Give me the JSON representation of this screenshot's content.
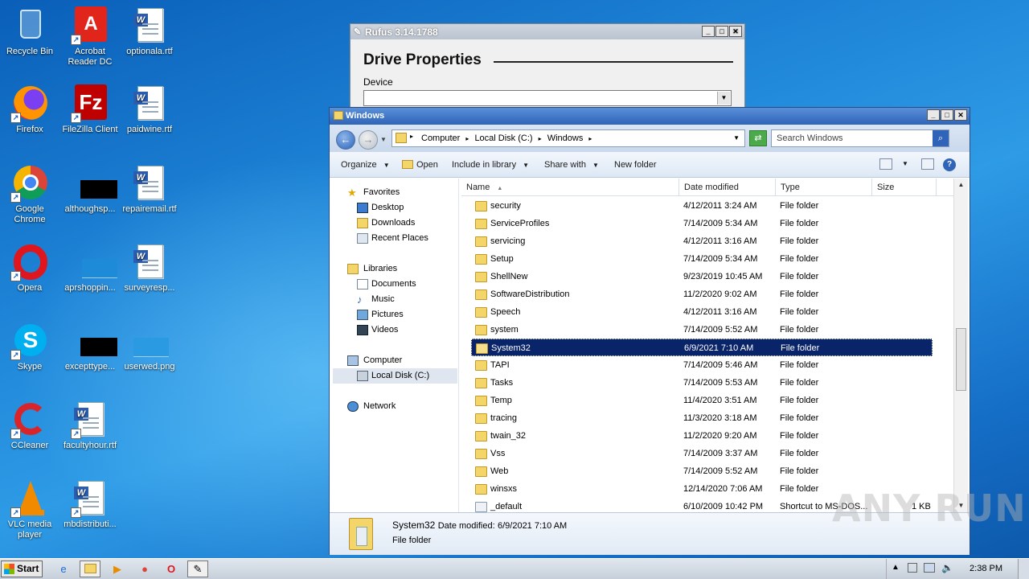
{
  "desktop": {
    "icons": [
      {
        "label": "Recycle Bin"
      },
      {
        "label": "Acrobat Reader DC"
      },
      {
        "label": "optionala.rtf"
      },
      {
        "label": "Firefox"
      },
      {
        "label": "FileZilla Client"
      },
      {
        "label": "paidwine.rtf"
      },
      {
        "label": "Google Chrome"
      },
      {
        "label": "althoughsp..."
      },
      {
        "label": "repairemail.rtf"
      },
      {
        "label": "Opera"
      },
      {
        "label": "aprshoppin..."
      },
      {
        "label": "surveyresp..."
      },
      {
        "label": "Skype"
      },
      {
        "label": "excepttype..."
      },
      {
        "label": "userwed.png"
      },
      {
        "label": "CCleaner"
      },
      {
        "label": "facultyhour.rtf"
      },
      {
        "label": "VLC media player"
      },
      {
        "label": "mbdistributi..."
      }
    ]
  },
  "rufus": {
    "title": "Rufus 3.14.1788",
    "heading": "Drive Properties",
    "device_label": "Device"
  },
  "explorer": {
    "title": "Windows",
    "breadcrumb": [
      "Computer",
      "Local Disk (C:)",
      "Windows"
    ],
    "search_placeholder": "Search Windows",
    "toolbar": {
      "organize": "Organize",
      "open": "Open",
      "include_in_library": "Include in library",
      "share_with": "Share with",
      "new_folder": "New folder"
    },
    "nav": {
      "favorites": "Favorites",
      "desktop": "Desktop",
      "downloads": "Downloads",
      "recent_places": "Recent Places",
      "libraries": "Libraries",
      "documents": "Documents",
      "music": "Music",
      "pictures": "Pictures",
      "videos": "Videos",
      "computer": "Computer",
      "local_disk": "Local Disk (C:)",
      "network": "Network"
    },
    "columns": {
      "name": "Name",
      "date": "Date modified",
      "type": "Type",
      "size": "Size"
    },
    "rows": [
      {
        "name": "security",
        "date": "4/12/2011 3:24 AM",
        "type": "File folder",
        "size": ""
      },
      {
        "name": "ServiceProfiles",
        "date": "7/14/2009 5:34 AM",
        "type": "File folder",
        "size": ""
      },
      {
        "name": "servicing",
        "date": "4/12/2011 3:16 AM",
        "type": "File folder",
        "size": ""
      },
      {
        "name": "Setup",
        "date": "7/14/2009 5:34 AM",
        "type": "File folder",
        "size": ""
      },
      {
        "name": "ShellNew",
        "date": "9/23/2019 10:45 AM",
        "type": "File folder",
        "size": ""
      },
      {
        "name": "SoftwareDistribution",
        "date": "11/2/2020 9:02 AM",
        "type": "File folder",
        "size": ""
      },
      {
        "name": "Speech",
        "date": "4/12/2011 3:16 AM",
        "type": "File folder",
        "size": ""
      },
      {
        "name": "system",
        "date": "7/14/2009 5:52 AM",
        "type": "File folder",
        "size": ""
      },
      {
        "name": "System32",
        "date": "6/9/2021 7:10 AM",
        "type": "File folder",
        "size": ""
      },
      {
        "name": "TAPI",
        "date": "7/14/2009 5:46 AM",
        "type": "File folder",
        "size": ""
      },
      {
        "name": "Tasks",
        "date": "7/14/2009 5:53 AM",
        "type": "File folder",
        "size": ""
      },
      {
        "name": "Temp",
        "date": "11/4/2020 3:51 AM",
        "type": "File folder",
        "size": ""
      },
      {
        "name": "tracing",
        "date": "11/3/2020 3:18 AM",
        "type": "File folder",
        "size": ""
      },
      {
        "name": "twain_32",
        "date": "11/2/2020 9:20 AM",
        "type": "File folder",
        "size": ""
      },
      {
        "name": "Vss",
        "date": "7/14/2009 3:37 AM",
        "type": "File folder",
        "size": ""
      },
      {
        "name": "Web",
        "date": "7/14/2009 5:52 AM",
        "type": "File folder",
        "size": ""
      },
      {
        "name": "winsxs",
        "date": "12/14/2020 7:06 AM",
        "type": "File folder",
        "size": ""
      },
      {
        "name": "_default",
        "date": "6/10/2009 10:42 PM",
        "type": "Shortcut to MS-DOS...",
        "size": "1 KB"
      }
    ],
    "selected_row": "System32",
    "details": {
      "name": "System32",
      "date_label": "Date modified:",
      "date_value": "6/9/2021 7:10 AM",
      "type": "File folder"
    }
  },
  "watermark": "ANY RUN",
  "taskbar": {
    "start_label": "Start",
    "clock": "2:38 PM"
  }
}
